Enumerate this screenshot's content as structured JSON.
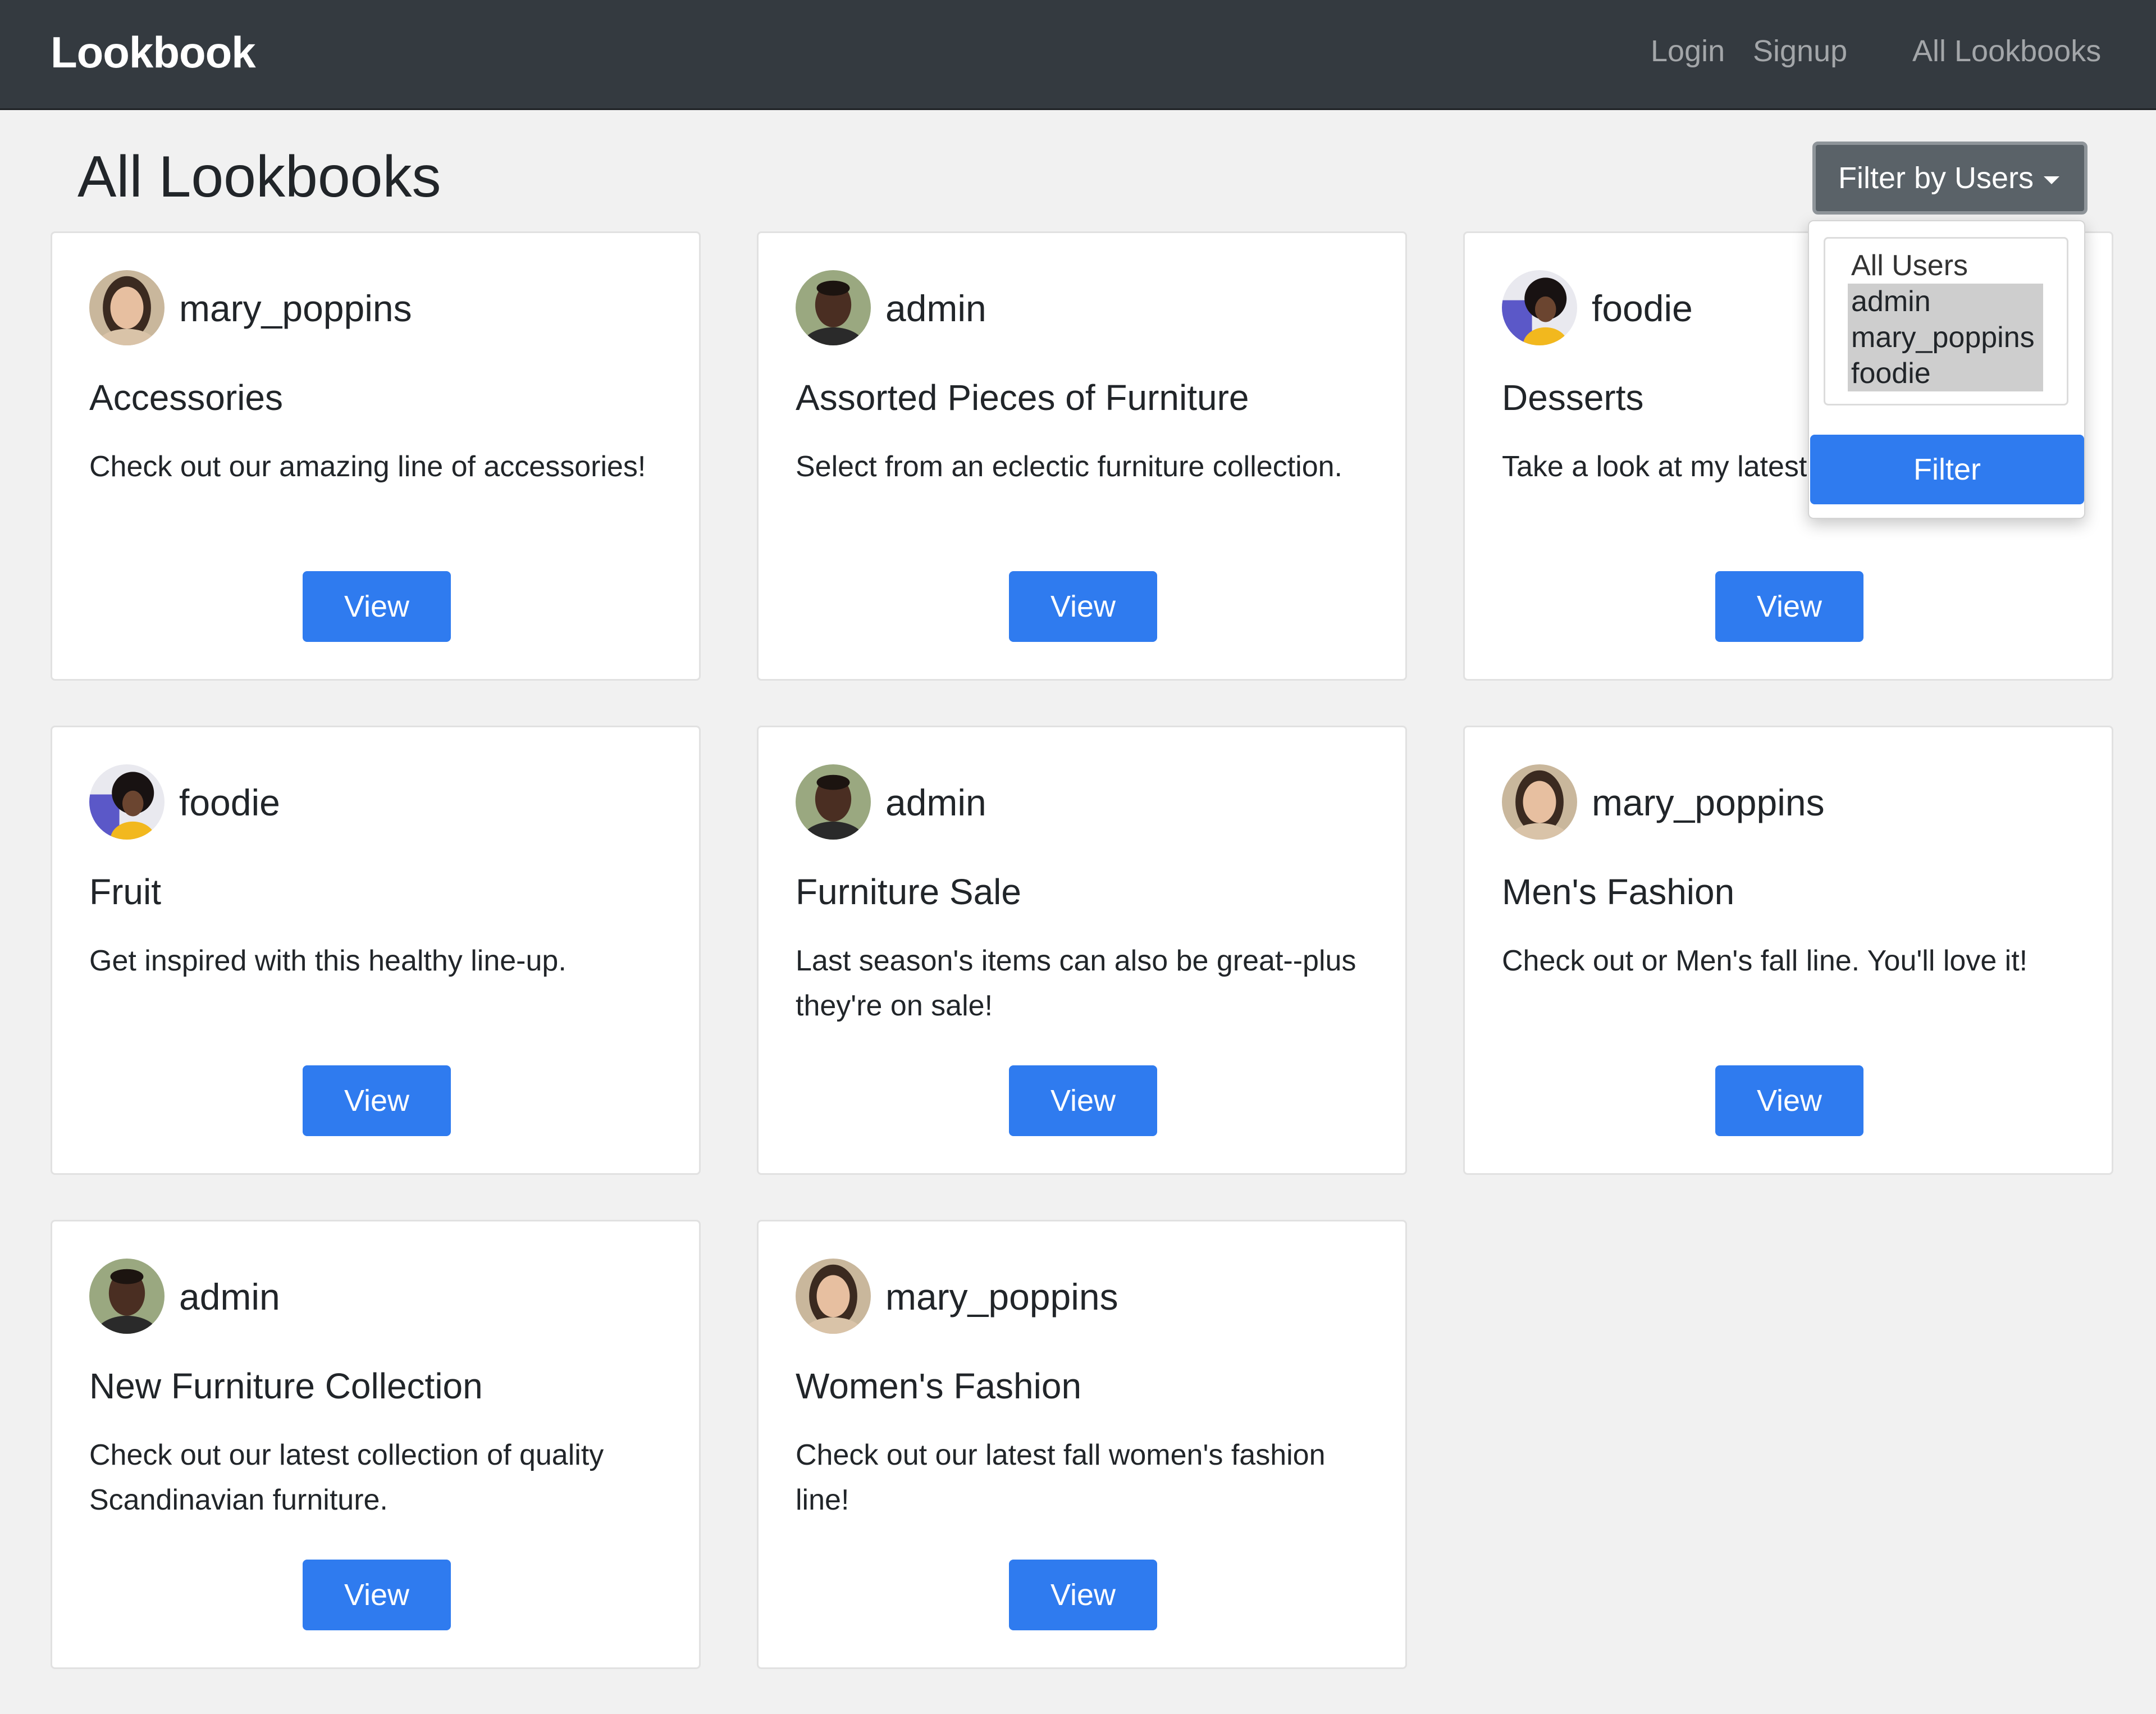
{
  "navbar": {
    "brand": "Lookbook",
    "links": {
      "login": "Login",
      "signup": "Signup",
      "all_lookbooks": "All Lookbooks"
    }
  },
  "page": {
    "title": "All Lookbooks"
  },
  "filter": {
    "button_label": "Filter by Users",
    "options": [
      "All Users",
      "admin",
      "mary_poppins",
      "foodie"
    ],
    "selected": [
      "admin",
      "mary_poppins",
      "foodie"
    ],
    "submit_label": "Filter"
  },
  "cards": [
    {
      "user": "mary_poppins",
      "title": "Accessories",
      "description": "Check out our amazing line of accessories!",
      "button": "View"
    },
    {
      "user": "admin",
      "title": "Assorted Pieces of Furniture",
      "description": "Select from an eclectic furniture collection.",
      "button": "View"
    },
    {
      "user": "foodie",
      "title": "Desserts",
      "description": "Take a look at my latest",
      "button": "View"
    },
    {
      "user": "foodie",
      "title": "Fruit",
      "description": "Get inspired with this healthy line-up.",
      "button": "View"
    },
    {
      "user": "admin",
      "title": "Furniture Sale",
      "description": "Last season's items can also be great--plus they're on sale!",
      "button": "View"
    },
    {
      "user": "mary_poppins",
      "title": "Men's Fashion",
      "description": "Check out or Men's fall line. You'll love it!",
      "button": "View"
    },
    {
      "user": "admin",
      "title": "New Furniture Collection",
      "description": "Check out our latest collection of quality Scandinavian furniture.",
      "button": "View"
    },
    {
      "user": "mary_poppins",
      "title": "Women's Fashion",
      "description": "Check out our latest fall women's fashion line!",
      "button": "View"
    }
  ],
  "colors": {
    "navbar_bg": "#343a40",
    "primary_button": "#2f7bef",
    "secondary_button": "#5a6268",
    "page_bg": "#f1f1f1"
  }
}
